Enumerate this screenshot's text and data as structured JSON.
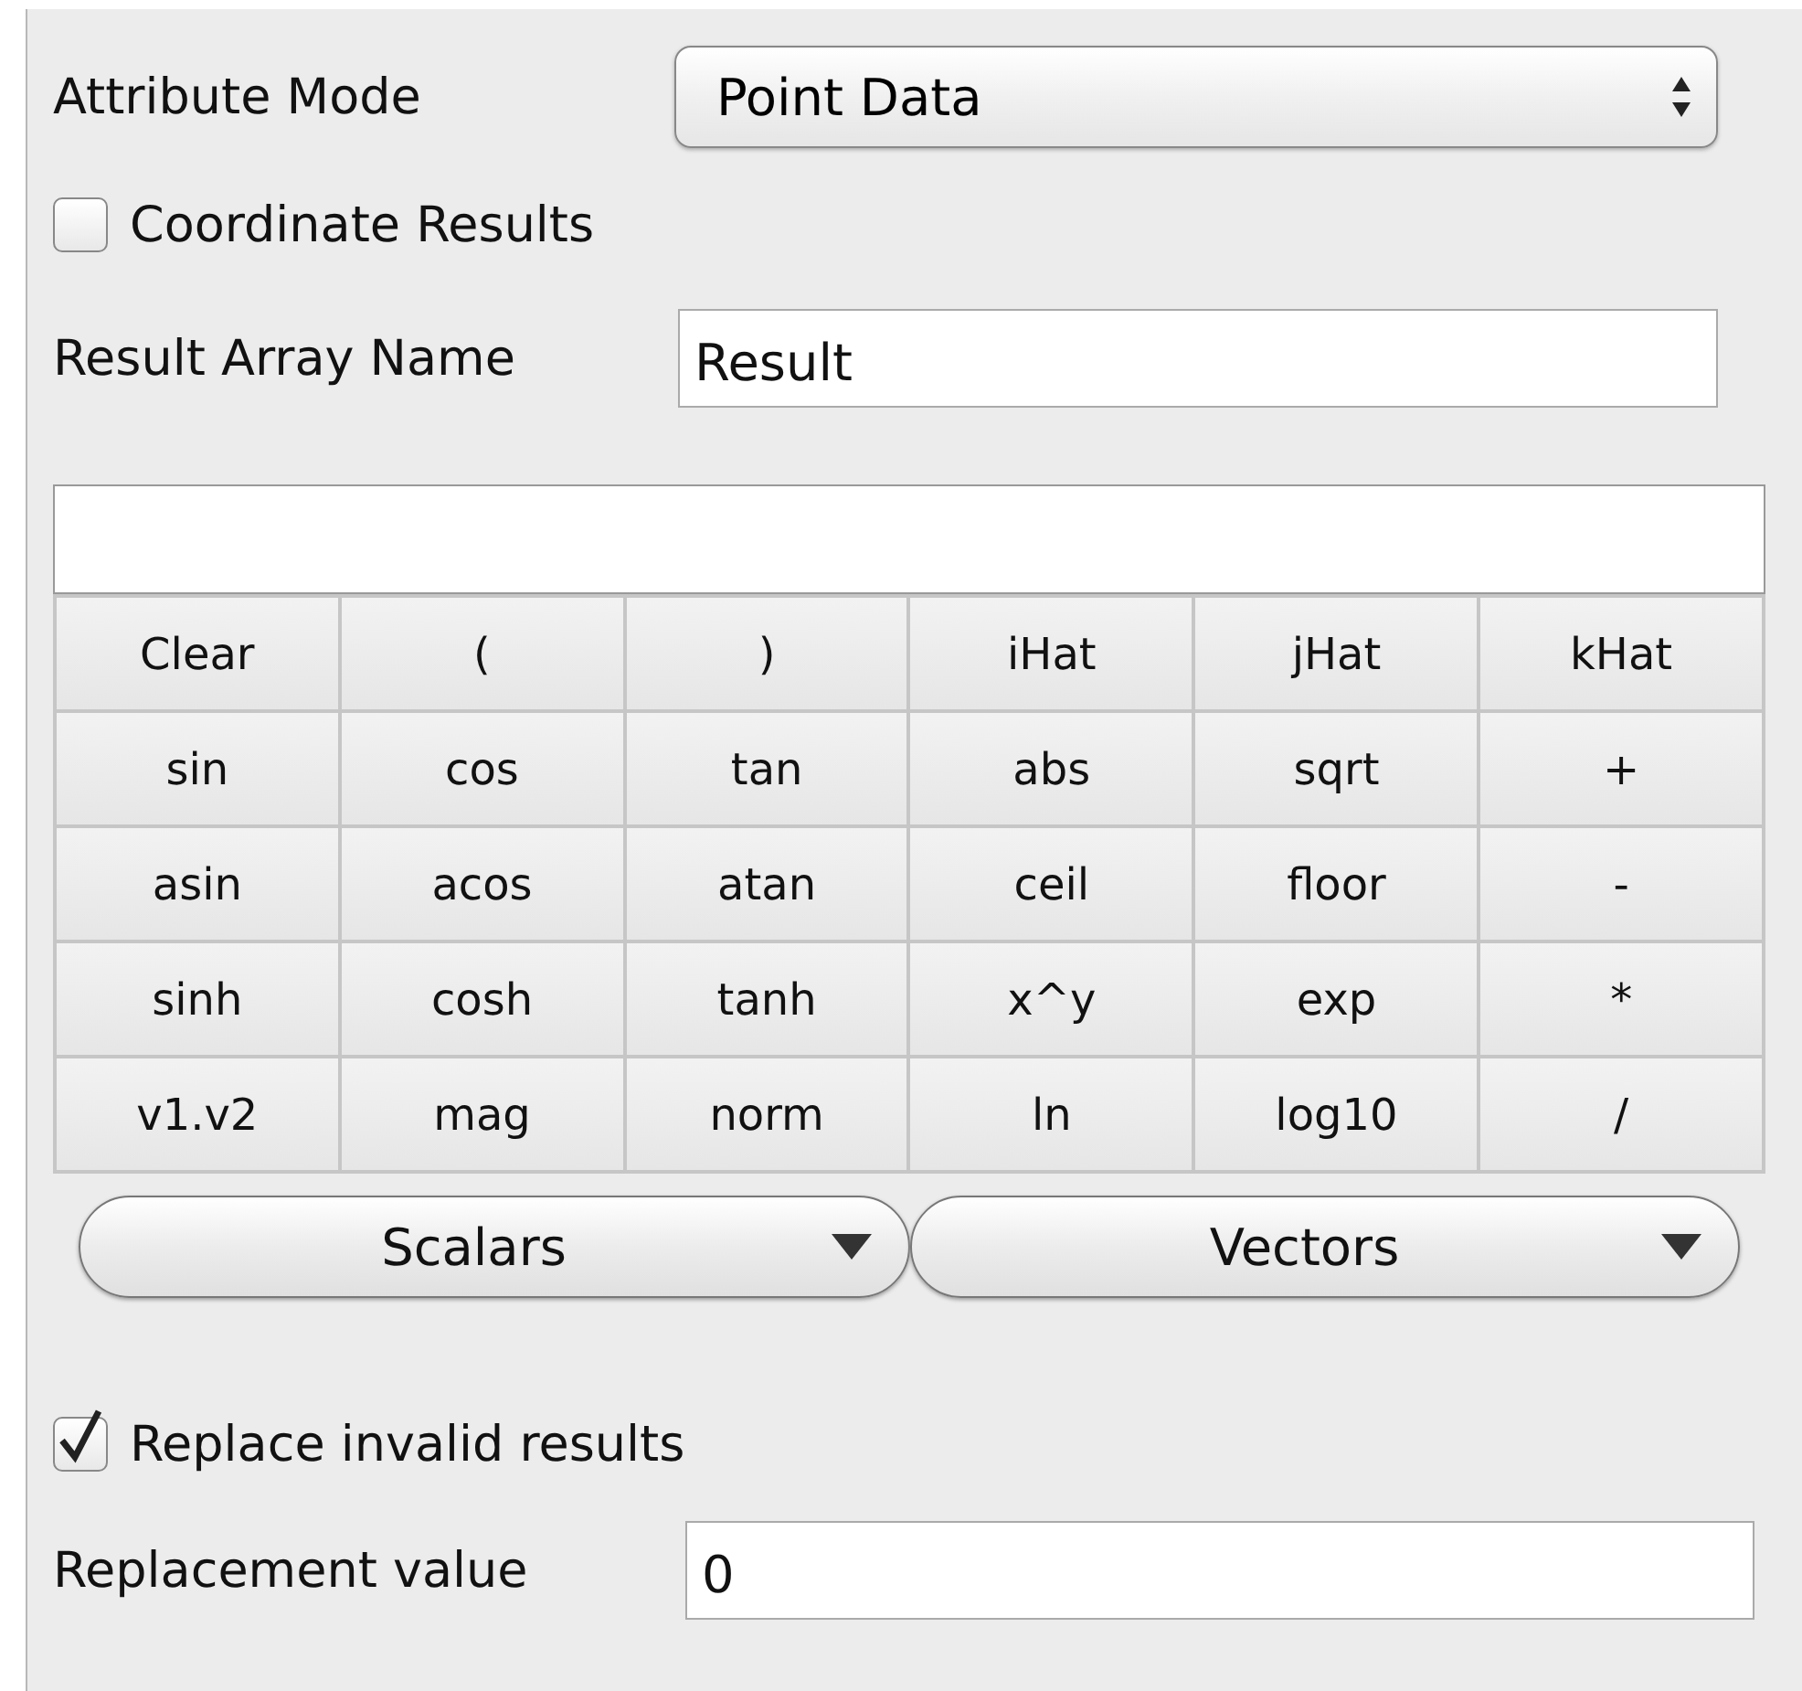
{
  "attribute_mode": {
    "label": "Attribute Mode",
    "value": "Point Data"
  },
  "coordinate_results": {
    "label": "Coordinate Results",
    "checked": false
  },
  "result_array_name": {
    "label": "Result Array Name",
    "value": "Result"
  },
  "keypad": [
    [
      "Clear",
      "(",
      ")",
      "iHat",
      "jHat",
      "kHat"
    ],
    [
      "sin",
      "cos",
      "tan",
      "abs",
      "sqrt",
      "+"
    ],
    [
      "asin",
      "acos",
      "atan",
      "ceil",
      "floor",
      "-"
    ],
    [
      "sinh",
      "cosh",
      "tanh",
      "x^y",
      "exp",
      "*"
    ],
    [
      "v1.v2",
      "mag",
      "norm",
      "ln",
      "log10",
      "/"
    ]
  ],
  "menus": [
    "Scalars",
    "Vectors"
  ],
  "replace_invalid": {
    "label": "Replace invalid results",
    "checked": true
  },
  "replacement_value": {
    "label": "Replacement value",
    "value": "0"
  }
}
